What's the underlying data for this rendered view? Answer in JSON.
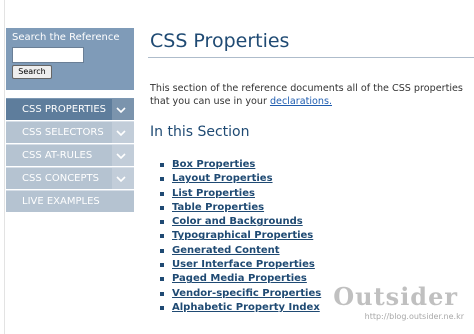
{
  "search": {
    "title": "Search the Reference",
    "input_value": "",
    "button_label": "Search"
  },
  "nav": {
    "items": [
      {
        "label": "CSS PROPERTIES",
        "active": true,
        "has_chevron": true
      },
      {
        "label": "CSS SELECTORS",
        "active": false,
        "has_chevron": true
      },
      {
        "label": "CSS AT-RULES",
        "active": false,
        "has_chevron": true
      },
      {
        "label": "CSS CONCEPTS",
        "active": false,
        "has_chevron": true
      },
      {
        "label": "LIVE EXAMPLES",
        "active": false,
        "has_chevron": false
      }
    ]
  },
  "main": {
    "title": "CSS Properties",
    "intro_text": "This section of the reference documents all of the CSS properties",
    "intro_text_2": "that you can use in your ",
    "intro_link": "declarations.",
    "section_title": "In this Section",
    "links": [
      "Box Properties",
      "Layout Properties",
      "List Properties",
      "Table Properties",
      "Color and Backgrounds",
      "Typographical Properties",
      "Generated Content",
      "User Interface Properties",
      "Paged Media Properties",
      "Vendor-specific Properties",
      "Alphabetic Property Index"
    ]
  },
  "watermark": {
    "title": "Outsider",
    "url": "http://blog.outsider.ne.kr"
  },
  "colors": {
    "heading": "#1f4a73",
    "nav_active": "#5e7d9c",
    "nav_inactive": "#b5c3d1",
    "search_box": "#7f9bb8",
    "link": "#1f5db0"
  }
}
